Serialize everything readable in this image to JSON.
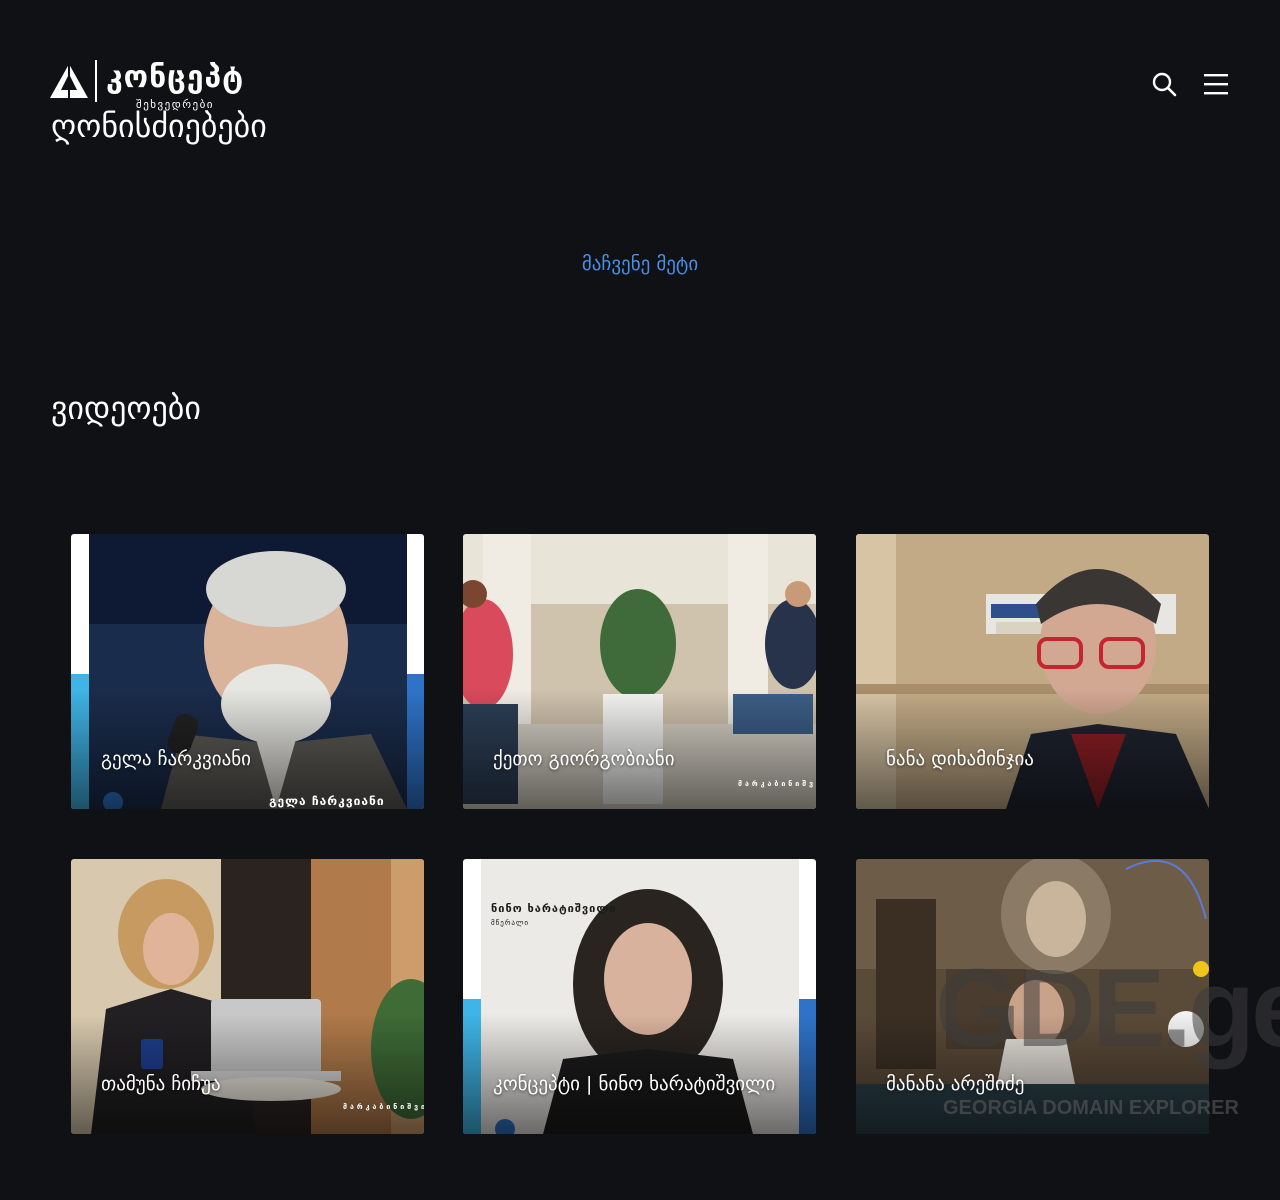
{
  "header": {
    "logo_name": "კონცეპტ",
    "logo_tagline": "შეხვედრები",
    "events_title": "ღონისძიებები",
    "search_icon": "search-icon",
    "menu_icon": "hamburger-menu-icon"
  },
  "events": {
    "show_more_label": "მაჩვენე მეტი"
  },
  "videos": {
    "title": "ვიდეოები",
    "items": [
      {
        "label": "გელა ჩარკვიანი",
        "overlay": "გელა ჩარკვიანი"
      },
      {
        "label": "ქეთო გიორგობიანი",
        "overlay": "მარკაბინიშვილი"
      },
      {
        "label": "ნანა დიხამინჯია",
        "overlay": ""
      },
      {
        "label": "თამუნა ჩიჩუა",
        "overlay": "მარკაბინიშვილი"
      },
      {
        "label": "კონცეპტი | ნინო ხარატიშვილი",
        "overlay": "ნინო ხარატიშვილი",
        "overlay_sub": "მწერალი"
      },
      {
        "label": "მანანა არეშიძე",
        "overlay": ""
      }
    ]
  },
  "watermark": {
    "big": "GDE.ge",
    "small": "GEORGIA DOMAIN EXPLORER"
  },
  "colors": {
    "background": "#101114",
    "link": "#4a8fe7",
    "accent_blue": "#2f73c9",
    "accent_cyan": "#3fb4e6"
  }
}
